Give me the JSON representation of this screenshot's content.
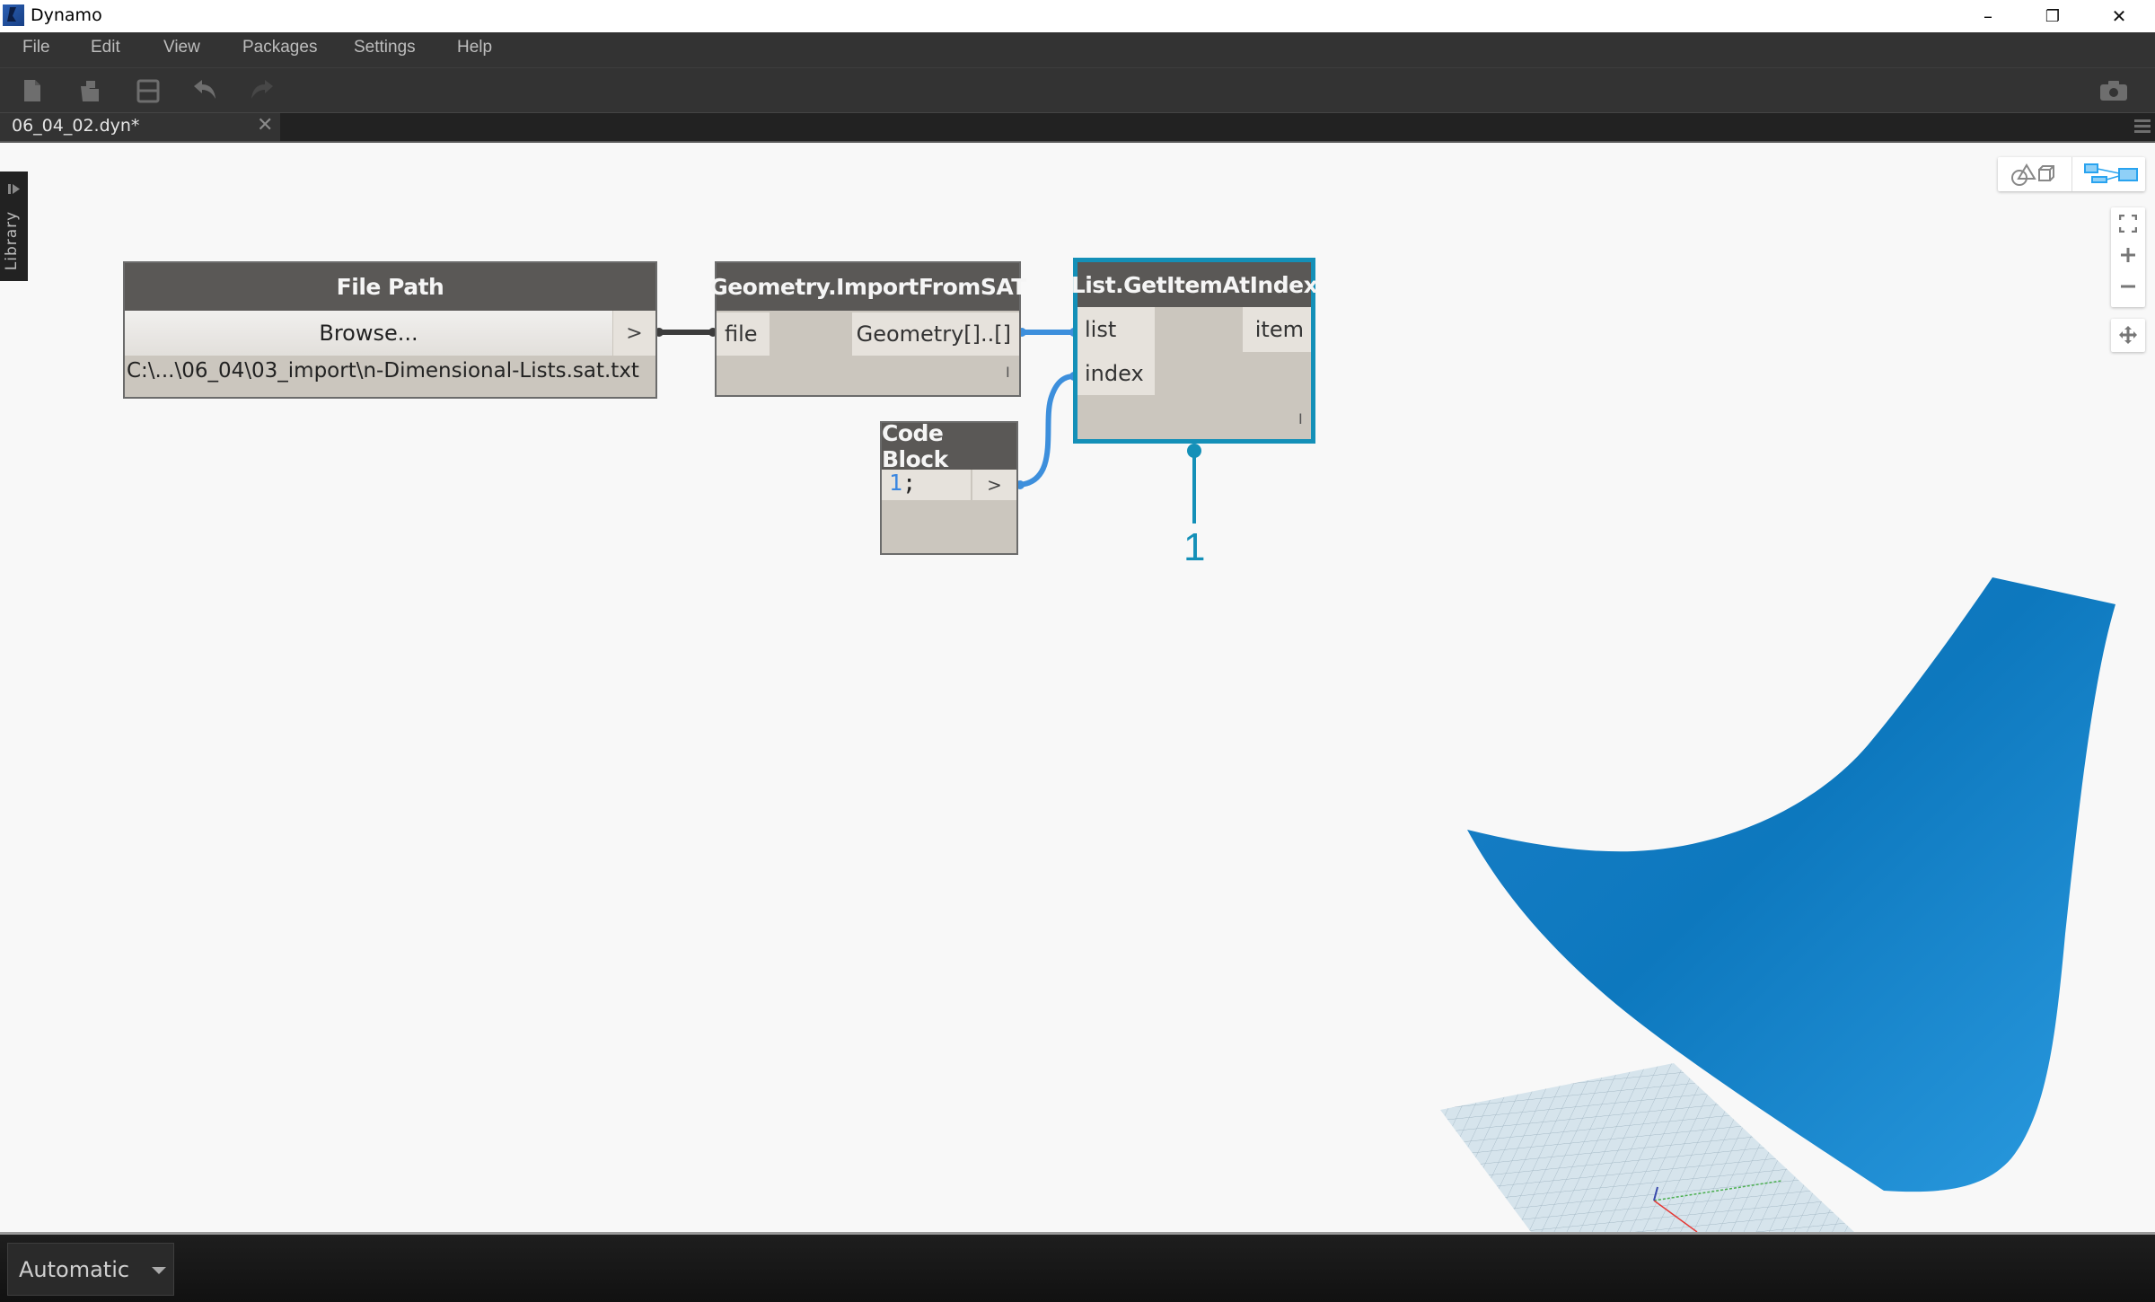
{
  "window": {
    "title": "Dynamo",
    "controls": {
      "minimize": "–",
      "restore": "❐",
      "close": "✕"
    }
  },
  "menu": {
    "items": [
      {
        "label": "File"
      },
      {
        "label": "Edit"
      },
      {
        "label": "View"
      },
      {
        "label": "Packages"
      },
      {
        "label": "Settings"
      },
      {
        "label": "Help"
      }
    ]
  },
  "toolbar": {
    "icons": [
      "new-file-icon",
      "open-file-icon",
      "save-icon",
      "undo-icon",
      "redo-icon"
    ],
    "screenshot_icon": "camera-icon"
  },
  "tabs": {
    "active": {
      "label": "06_04_02.dyn*",
      "close": "✕"
    }
  },
  "library": {
    "label": "Library"
  },
  "nodes": {
    "file_path": {
      "title": "File Path",
      "browse_label": "Browse...",
      "output_arrow": ">",
      "value": "C:\\...\\06_04\\03_import\\n-Dimensional-Lists.sat.txt"
    },
    "import_sat": {
      "title": "Geometry.ImportFromSAT",
      "input": "file",
      "output": "Geometry[]..[]",
      "lacing": "I"
    },
    "get_item": {
      "title": "List.GetItemAtIndex",
      "inputs": [
        "list",
        "index"
      ],
      "output": "item",
      "lacing": "I",
      "preview_value": "1"
    },
    "code_block": {
      "title": "Code Block",
      "code_number": "1",
      "code_suffix": ";",
      "output_arrow": ">"
    }
  },
  "colors": {
    "wire_active": "#3d8fdc",
    "wire_default": "#3c3c3c",
    "selection": "#1490b8",
    "geometry": "#1e88d0"
  },
  "bottom": {
    "run_mode": "Automatic"
  }
}
